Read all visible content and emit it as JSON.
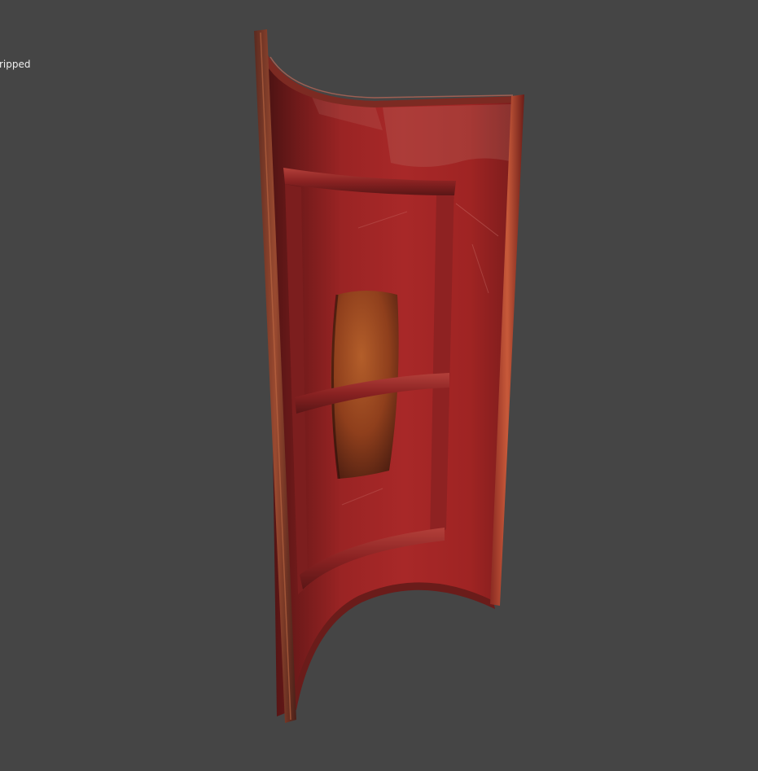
{
  "viewport": {
    "label": "ripped",
    "background_color": "#454545",
    "label_color": "#f0f0f0"
  },
  "model": {
    "name": "shield",
    "main_color": "#9f2423",
    "rim_color": "#7a2a1c",
    "boss_color": "#a14b25"
  }
}
